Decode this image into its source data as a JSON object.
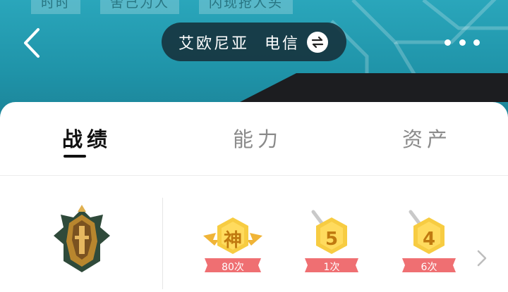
{
  "header": {
    "top_tags": [
      "时时",
      "舍己为人",
      "闪现抢人头"
    ],
    "server_name": "艾欧尼亚",
    "server_isp": "电信",
    "back_icon": "chevron-left-icon",
    "more_icon": "more-dots-icon",
    "swap_icon": "swap-arrows-icon"
  },
  "tabs": [
    {
      "label": "战绩",
      "active": true
    },
    {
      "label": "能力",
      "active": false
    },
    {
      "label": "资产",
      "active": false
    }
  ],
  "rank": {
    "icon": "rank-emblem-icon"
  },
  "badges": [
    {
      "char": "神",
      "count_label": "80次",
      "icon": "winged-god-badge-icon"
    },
    {
      "char": "5",
      "count_label": "1次",
      "icon": "sword-badge-5-icon"
    },
    {
      "char": "4",
      "count_label": "6次",
      "icon": "sword-badge-4-icon"
    }
  ],
  "colors": {
    "header_teal": "#2aa6bb",
    "badge_gold": "#f4c43a",
    "ribbon_red": "#ef6f72"
  }
}
